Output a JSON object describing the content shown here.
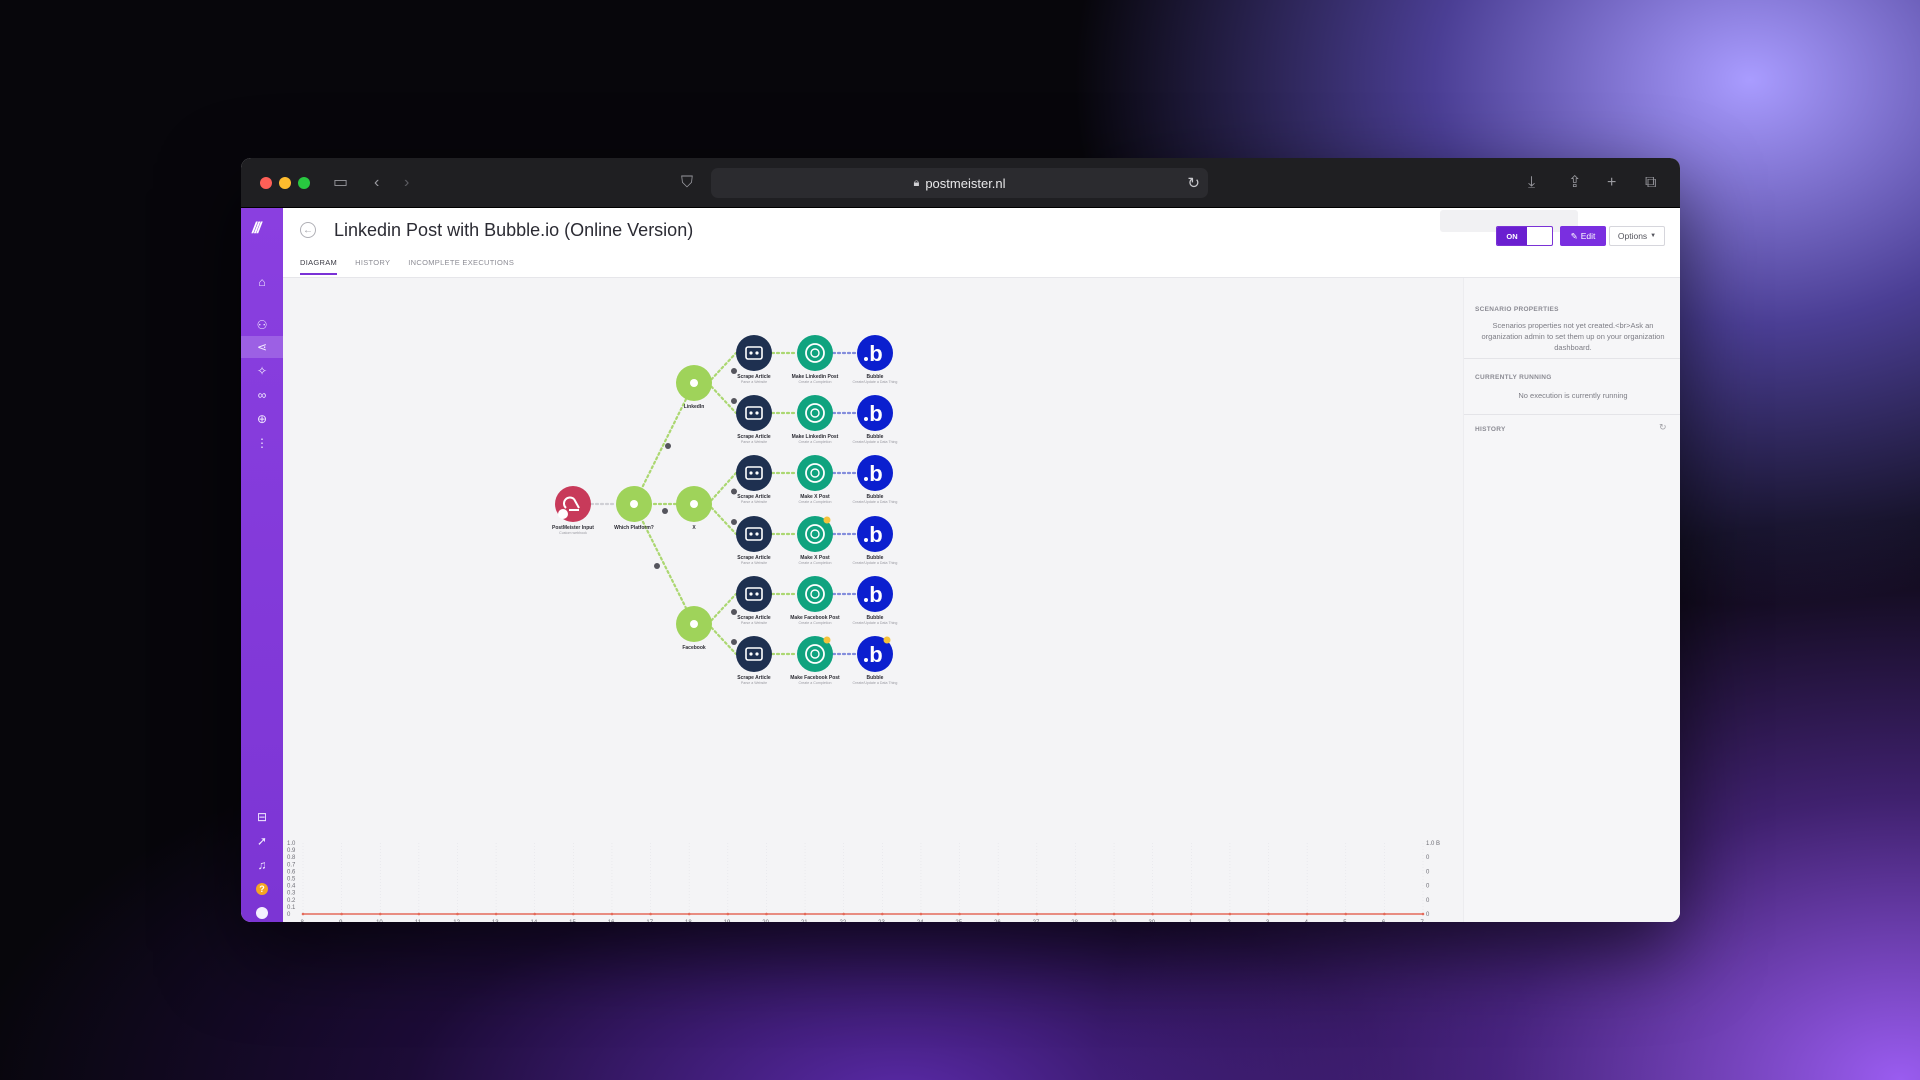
{
  "browser": {
    "url": "postmeister.nl"
  },
  "sidebar": {
    "items": [
      {
        "icon": "home-icon"
      },
      {
        "icon": "team-icon"
      },
      {
        "icon": "share-icon",
        "active": true
      },
      {
        "icon": "puzzle-icon"
      },
      {
        "icon": "link-icon"
      },
      {
        "icon": "globe-icon"
      },
      {
        "icon": "more-icon"
      }
    ],
    "bottom_items": [
      {
        "icon": "book-icon"
      },
      {
        "icon": "rocket-icon"
      },
      {
        "icon": "bell-icon"
      },
      {
        "icon": "help-icon"
      },
      {
        "icon": "avatar-icon"
      }
    ]
  },
  "header": {
    "title": "Linkedin Post with Bubble.io (Online Version)",
    "tabs": [
      "DIAGRAM",
      "HISTORY",
      "INCOMPLETE EXECUTIONS"
    ],
    "toggle_label": "ON",
    "edit_label": "Edit",
    "options_label": "Options"
  },
  "scenario": {
    "input": {
      "label": "PostMeister Input",
      "sub": "Custom webhook"
    },
    "router": {
      "label": "Which Platform?"
    },
    "platforms": [
      {
        "label": "LinkedIn"
      },
      {
        "label": "X"
      },
      {
        "label": "Facebook"
      }
    ],
    "rows": [
      {
        "scrape": "Scrape Article",
        "scrape_sub": "Parse a Website",
        "gpt": "Make Linkedin Post",
        "gpt_sub": "Create a Completion",
        "bubble": "Bubble",
        "bubble_sub": "Create/Update a Data Thing"
      },
      {
        "scrape": "Scrape Article",
        "scrape_sub": "Parse a Website",
        "gpt": "Make Linkedin Post",
        "gpt_sub": "Create a Completion",
        "bubble": "Bubble",
        "bubble_sub": "Create/Update a Data Thing"
      },
      {
        "scrape": "Scrape Article",
        "scrape_sub": "Parse a Website",
        "gpt": "Make X Post",
        "gpt_sub": "Create a Completion",
        "bubble": "Bubble",
        "bubble_sub": "Create/Update a Data Thing"
      },
      {
        "scrape": "Scrape Article",
        "scrape_sub": "Parse a Website",
        "gpt": "Make X Post",
        "gpt_sub": "Create a Completion",
        "bubble": "Bubble",
        "bubble_sub": "Create/Update a Data Thing"
      },
      {
        "scrape": "Scrape Article",
        "scrape_sub": "Parse a Website",
        "gpt": "Make Facebook Post",
        "gpt_sub": "Create a Completion",
        "bubble": "Bubble",
        "bubble_sub": "Create/Update a Data Thing"
      },
      {
        "scrape": "Scrape Article",
        "scrape_sub": "Parse a Website",
        "gpt": "Make Facebook Post",
        "gpt_sub": "Create a Completion",
        "bubble": "Bubble",
        "bubble_sub": "Create/Update a Data Thing"
      }
    ]
  },
  "right_panel": {
    "scenario_properties_heading": "SCENARIO PROPERTIES",
    "scenario_properties_text": "Scenarios properties not yet created.<br>Ask an organization admin to set them up on your organization dashboard.",
    "currently_running_heading": "CURRENTLY RUNNING",
    "currently_running_text": "No execution is currently running",
    "history_heading": "HISTORY"
  },
  "usage_chart": {
    "left_ticks": [
      "1.0",
      "0.9",
      "0.8",
      "0.7",
      "0.6",
      "0.5",
      "0.4",
      "0.3",
      "0.2",
      "0.1",
      "0"
    ],
    "right_ticks": [
      "1.0 B",
      "0",
      "0",
      "0",
      "0",
      "0"
    ],
    "x_ticks": [
      "8.",
      "9.",
      "10.",
      "11.",
      "12.",
      "13.",
      "14.",
      "15.",
      "16.",
      "17.",
      "18.",
      "19.",
      "20.",
      "21.",
      "22.",
      "23.",
      "24.",
      "25.",
      "26.",
      "27.",
      "28.",
      "29.",
      "30.",
      "1.",
      "2.",
      "3.",
      "4.",
      "5.",
      "6.",
      "7."
    ]
  },
  "colors": {
    "brand_purple": "#7a32d6",
    "router_green": "#9fd35a",
    "openai_teal": "#10a37f",
    "scrape_navy": "#1e3050",
    "bubble_blue": "#0b1fcf",
    "webhook_red": "#c83a5a"
  }
}
